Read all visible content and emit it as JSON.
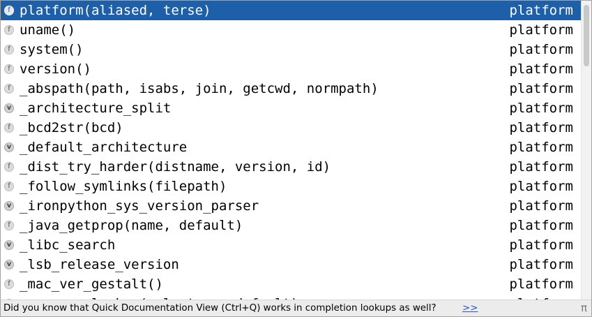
{
  "completion": {
    "items": [
      {
        "icon": "function-icon",
        "glyph": "f",
        "name": "platform(aliased, terse)",
        "source": "platform",
        "selected": true
      },
      {
        "icon": "function-icon",
        "glyph": "f",
        "name": "uname()",
        "source": "platform"
      },
      {
        "icon": "function-icon",
        "glyph": "f",
        "name": "system()",
        "source": "platform"
      },
      {
        "icon": "function-icon",
        "glyph": "f",
        "name": "version()",
        "source": "platform"
      },
      {
        "icon": "function-icon",
        "glyph": "f",
        "name": "_abspath(path, isabs, join, getcwd, normpath)",
        "source": "platform"
      },
      {
        "icon": "variable-icon",
        "glyph": "v",
        "name": "_architecture_split",
        "source": "platform"
      },
      {
        "icon": "function-icon",
        "glyph": "f",
        "name": "_bcd2str(bcd)",
        "source": "platform"
      },
      {
        "icon": "variable-icon",
        "glyph": "v",
        "name": "_default_architecture",
        "source": "platform"
      },
      {
        "icon": "function-icon",
        "glyph": "f",
        "name": "_dist_try_harder(distname, version, id)",
        "source": "platform"
      },
      {
        "icon": "function-icon",
        "glyph": "f",
        "name": "_follow_symlinks(filepath)",
        "source": "platform"
      },
      {
        "icon": "variable-icon",
        "glyph": "v",
        "name": "_ironpython_sys_version_parser",
        "source": "platform"
      },
      {
        "icon": "function-icon",
        "glyph": "f",
        "name": "_java_getprop(name, default)",
        "source": "platform"
      },
      {
        "icon": "variable-icon",
        "glyph": "v",
        "name": "_libc_search",
        "source": "platform"
      },
      {
        "icon": "variable-icon",
        "glyph": "v",
        "name": "_lsb_release_version",
        "source": "platform"
      },
      {
        "icon": "function-icon",
        "glyph": "f",
        "name": "_mac_ver_gestalt()",
        "source": "platform"
      },
      {
        "icon": "function-icon",
        "glyph": "f",
        "name": "_mac_ver_lookup(selectors, default)",
        "source": "platform"
      }
    ]
  },
  "footer": {
    "tip": "Did you know that Quick Documentation View (Ctrl+Q) works in completion lookups as well?",
    "more_link": ">>",
    "pi_symbol": "π"
  },
  "colors": {
    "selection": "#1d5fa8",
    "link": "#2a52be"
  }
}
